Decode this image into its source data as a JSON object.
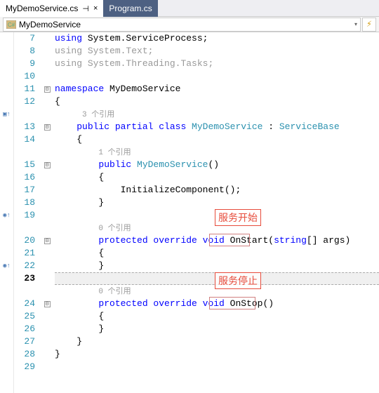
{
  "tabs": {
    "active": {
      "label": "MyDemoService.cs",
      "pin_glyph": "⊣",
      "close_glyph": "×"
    },
    "inactive": {
      "label": "Program.cs"
    }
  },
  "navbar": {
    "dropdown_label": "MyDemoService",
    "arrow_glyph": "▾",
    "lightning_glyph": "⚡"
  },
  "margin_glyphs": {
    "ref": "▣↑",
    "impl": "◉↑"
  },
  "line_numbers": [
    "7",
    "8",
    "9",
    "10",
    "11",
    "12",
    "",
    "13",
    "14",
    "",
    "15",
    "16",
    "17",
    "18",
    "19",
    "",
    "20",
    "21",
    "22",
    "23",
    "",
    "24",
    "25",
    "26",
    "27",
    "28",
    "29"
  ],
  "fold_markers": {
    "ns": "⊟",
    "cls": "⊟",
    "ctor": "⊟",
    "onstart": "⊟",
    "onstop": "⊟"
  },
  "code": {
    "using1_kw": "using",
    "using1_ns": " System.ServiceProcess;",
    "using2_kw": "using",
    "using2_ns": " System.Text;",
    "using3_kw": "using",
    "using3_ns": " System.Threading.Tasks;",
    "ns_kw": "namespace",
    "ns_name": " MyDemoService",
    "brace_open": "{",
    "brace_close": "}",
    "codelens3": "3 个引用",
    "class_mods": "public partial class ",
    "class_name": "MyDemoService",
    "class_colon": " : ",
    "class_base": "ServiceBase",
    "codelens1": "1 个引用",
    "ctor_mod": "public ",
    "ctor_name": "MyDemoService",
    "ctor_parens": "()",
    "init_call": "InitializeComponent();",
    "codelens0a": "0 个引用",
    "onstart_mods": "protected override void ",
    "onstart_name": "OnStart",
    "onstart_p_open": "(",
    "onstart_ptype": "string",
    "onstart_rest": "[] args)",
    "codelens0b": "0 个引用",
    "onstop_mods": "protected override void ",
    "onstop_name": "OnStop",
    "onstop_parens": "()"
  },
  "annotations": {
    "start": "服务开始",
    "stop": "服务停止"
  }
}
